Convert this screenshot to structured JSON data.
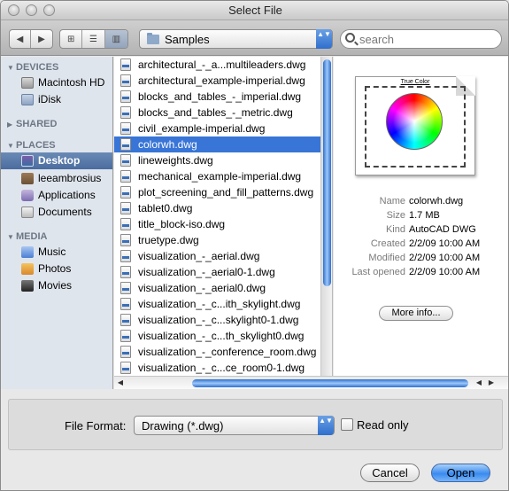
{
  "window": {
    "title": "Select File"
  },
  "toolbar": {
    "nav": {
      "back": "◀",
      "forward": "▶"
    },
    "views": {
      "icon": "⊞",
      "list": "☰",
      "column": "▥"
    },
    "location": "Samples",
    "popup_arrows": "▲▼",
    "search_placeholder": "search"
  },
  "sidebar": {
    "devices": {
      "title": "DEVICES",
      "items": [
        {
          "label": "Macintosh HD",
          "icon": "hard-drive-icon"
        },
        {
          "label": "iDisk",
          "icon": "idisk-icon"
        }
      ]
    },
    "shared": {
      "title": "SHARED"
    },
    "places": {
      "title": "PLACES",
      "items": [
        {
          "label": "Desktop",
          "icon": "desktop-icon",
          "selected": true
        },
        {
          "label": "leeambrosius",
          "icon": "home-icon"
        },
        {
          "label": "Applications",
          "icon": "applications-icon"
        },
        {
          "label": "Documents",
          "icon": "documents-icon"
        }
      ]
    },
    "media": {
      "title": "MEDIA",
      "items": [
        {
          "label": "Music",
          "icon": "music-icon"
        },
        {
          "label": "Photos",
          "icon": "photos-icon"
        },
        {
          "label": "Movies",
          "icon": "movies-icon"
        }
      ]
    }
  },
  "files": [
    "architectural_-_a...multileaders.dwg",
    "architectural_example-imperial.dwg",
    "blocks_and_tables_-_imperial.dwg",
    "blocks_and_tables_-_metric.dwg",
    "civil_example-imperial.dwg",
    "colorwh.dwg",
    "lineweights.dwg",
    "mechanical_example-imperial.dwg",
    "plot_screening_and_fill_patterns.dwg",
    "tablet0.dwg",
    "title_block-iso.dwg",
    "truetype.dwg",
    "visualization_-_aerial.dwg",
    "visualization_-_aerial0-1.dwg",
    "visualization_-_aerial0.dwg",
    "visualization_-_c...ith_skylight.dwg",
    "visualization_-_c...skylight0-1.dwg",
    "visualization_-_c...th_skylight0.dwg",
    "visualization_-_conference_room.dwg",
    "visualization_-_c...ce_room0-1.dwg"
  ],
  "selected_file_index": 5,
  "preview": {
    "thumbnail_caption": "True Color",
    "info": [
      {
        "label": "Name",
        "value": "colorwh.dwg"
      },
      {
        "label": "Size",
        "value": "1.7 MB"
      },
      {
        "label": "Kind",
        "value": "AutoCAD DWG"
      },
      {
        "label": "Created",
        "value": "2/2/09 10:00 AM"
      },
      {
        "label": "Modified",
        "value": "2/2/09 10:00 AM"
      },
      {
        "label": "Last opened",
        "value": "2/2/09 10:00 AM"
      }
    ],
    "more_info": "More info..."
  },
  "scroll": {
    "left": "◀",
    "right": "▶",
    "left_end": "◀"
  },
  "options": {
    "format_label": "File Format:",
    "format_value": "Drawing (*.dwg)",
    "read_only_label": "Read only",
    "read_only_checked": false
  },
  "buttons": {
    "cancel": "Cancel",
    "open": "Open"
  }
}
